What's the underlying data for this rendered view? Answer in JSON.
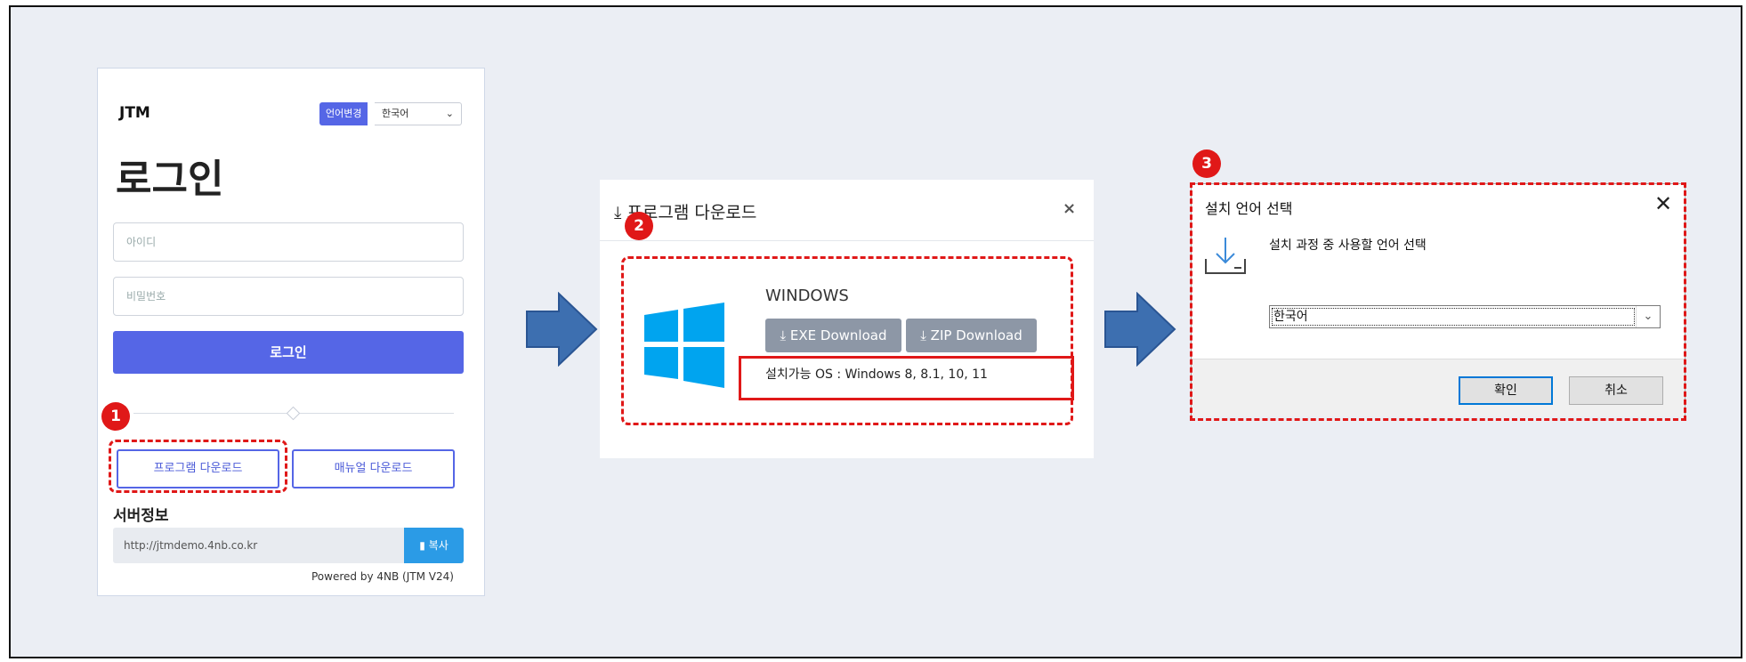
{
  "login": {
    "brand": "JTM",
    "lang_change": "언어변경",
    "lang_value": "한국어",
    "title": "로그인",
    "id_placeholder": "아이디",
    "pw_placeholder": "비밀번호",
    "login_button": "로그인",
    "program_download": "프로그램 다운로드",
    "manual_download": "매뉴얼 다운로드",
    "server_label": "서버정보",
    "server_url": "http://jtmdemo.4nb.co.kr",
    "copy_button": "복사",
    "powered": "Powered by 4NB (JTM V24)"
  },
  "download_dialog": {
    "title": "프로그램 다운로드",
    "close": "×",
    "os_name": "WINDOWS",
    "exe_button": "EXE Download",
    "zip_button": "ZIP Download",
    "supported_os": "설치가능 OS : Windows 8, 8.1, 10, 11"
  },
  "installer": {
    "title": "설치 언어 선택",
    "close": "✕",
    "message": "설치 과정 중 사용할 언어 선택",
    "selected_language": "한국어",
    "ok_button": "확인",
    "cancel_button": "취소"
  },
  "badges": [
    "1",
    "2",
    "3"
  ],
  "colors": {
    "highlight": "#e01818",
    "arrow": "#3d6fb0",
    "primary": "#5566e6",
    "windows_blue": "#00a4ef"
  }
}
